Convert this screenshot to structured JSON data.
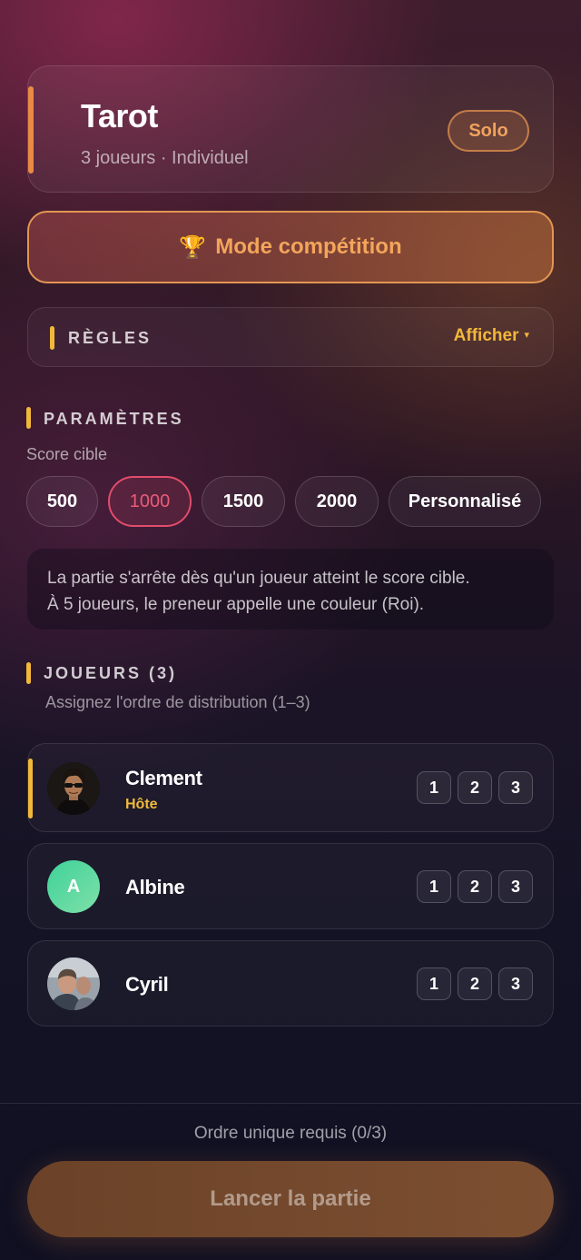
{
  "game": {
    "title": "Tarot",
    "subtitle": "3 joueurs · Individuel",
    "mode_badge": "Solo",
    "accent_color": "#e98a45"
  },
  "competition": {
    "icon": "trophy-icon",
    "icon_glyph": "🏆",
    "label": "Mode compétition"
  },
  "rules": {
    "title": "RÈGLES",
    "toggle_label": "Afficher",
    "toggle_glyph": "▾"
  },
  "params": {
    "title": "PARAMÈTRES",
    "score_label": "Score cible",
    "score_options": [
      "500",
      "1000",
      "1500",
      "2000",
      "Personnalisé"
    ],
    "selected_score": "1000",
    "info_line1": "La partie s'arrête dès qu'un joueur atteint le score cible.",
    "info_line2": "À 5 joueurs, le preneur appelle une couleur (Roi)."
  },
  "players": {
    "title": "JOUEURS (3)",
    "subtitle": "Assignez l'ordre de distribution (1–3)",
    "order_options": [
      "1",
      "2",
      "3"
    ],
    "list": [
      {
        "name": "Clement",
        "role": "Hôte",
        "avatar": "photo"
      },
      {
        "name": "Albine",
        "avatar": "letter",
        "avatar_letter": "A"
      },
      {
        "name": "Cyril",
        "avatar": "photo"
      }
    ]
  },
  "footer": {
    "order_status": "Ordre unique requis (0/3)",
    "launch_label": "Lancer la partie"
  },
  "colors": {
    "accent_orange": "#e39653",
    "accent_yellow": "#f1b83a",
    "selected_pink": "#e24c6b",
    "avatar_green": "#3ed29a"
  }
}
